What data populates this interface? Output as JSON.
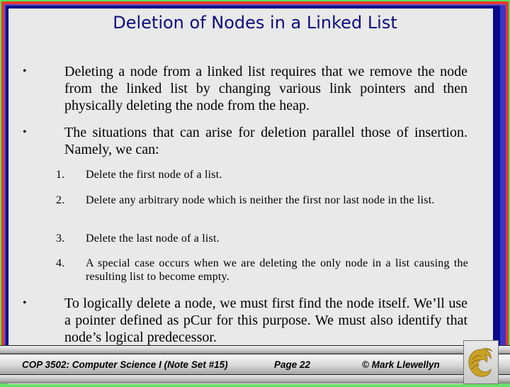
{
  "slide": {
    "title": "Deletion of Nodes in a Linked List",
    "bullets": [
      {
        "marker": "•",
        "text": "Deleting a node from a linked list requires that we remove the node from the linked list by changing various link pointers and then physically deleting the node from the heap."
      },
      {
        "marker": "•",
        "text": "The situations that can arise for deletion parallel those of insertion.  Namely, we can:"
      },
      {
        "marker": "•",
        "text": "To logically delete a node, we must first find the node itself.  We’ll use a pointer defined as pCur for this purpose.  We must also identify that node’s logical predecessor."
      }
    ],
    "numbered_items": [
      {
        "number": "1.",
        "text": "Delete the first node of a list."
      },
      {
        "number": "2.",
        "text": "Delete any arbitrary node which is neither the first nor last node in the list."
      },
      {
        "number": "3.",
        "text": "Delete the last node of a list."
      },
      {
        "number": "4.",
        "text": "A special case occurs when we are deleting the only node in a list causing the resulting list to become empty."
      }
    ]
  },
  "footer": {
    "course": "COP 3502: Computer Science I  (Note Set #15)",
    "page": "Page 22",
    "author": "© Mark Llewellyn",
    "logo_icon": "ucf-pegasus-logo-icon"
  },
  "colors": {
    "title": "#0c0c80",
    "border_green": "#5fe05a",
    "border_red": "#e8382e",
    "border_blue": "#3a36c8",
    "border_navy": "#0a0a8a",
    "slide_bg": "#e9e9e9",
    "logo_gold": "#c9a227"
  }
}
